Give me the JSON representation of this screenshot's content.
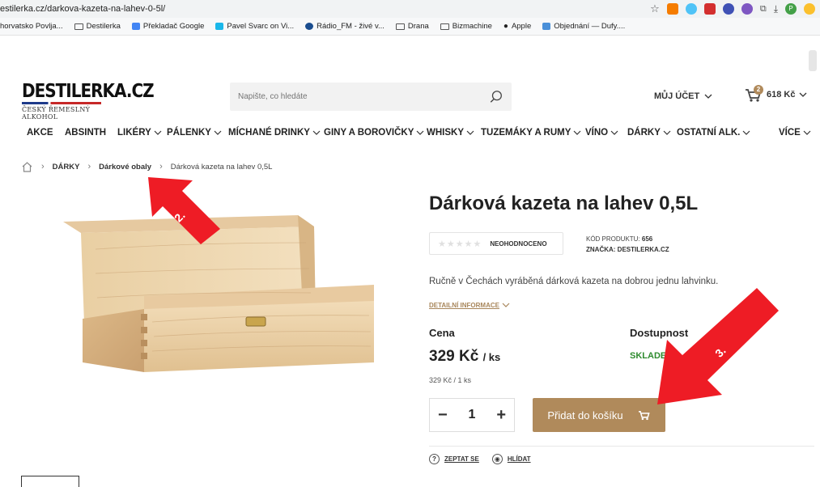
{
  "browser": {
    "url": "estilerka.cz/darkova-kazeta-na-lahev-0-5l/",
    "bookmarks": [
      "horvatsko Povlja...",
      "Destilerka",
      "Překladač Google",
      "Pavel Svarc on Vi...",
      "Rádio_FM - živé v...",
      "Drana",
      "Bizmachine",
      "Apple",
      "Objednání — Dufy...."
    ]
  },
  "header": {
    "logo_main": "DESTILERKA.CZ",
    "logo_sub": "ČESKÝ ŘEMESLNÝ ALKOHOL",
    "search_placeholder": "Napište, co hledáte",
    "account_label": "MŮJ ÚČET",
    "cart_count": "2",
    "cart_total": "618 Kč"
  },
  "nav": {
    "items": [
      "AKCE",
      "ABSINTH",
      "LIKÉRY",
      "PÁLENKY",
      "MÍCHANÉ DRINKY",
      "GINY A BOROVIČKY",
      "WHISKY",
      "TUZEMÁKY A RUMY",
      "VÍNO",
      "DÁRKY",
      "OSTATNÍ ALK.",
      "VÍCE"
    ]
  },
  "breadcrumb": {
    "level1": "DÁRKY",
    "level2": "Dárkové obaly",
    "current": "Dárková kazeta na lahev 0,5L"
  },
  "product": {
    "title": "Dárková kazeta na lahev 0,5L",
    "rating_text": "NEOHODNOCENO",
    "code_label": "KÓD PRODUKTU:",
    "code_value": "656",
    "brand_label": "ZNAČKA:",
    "brand_value": "DESTILERKA.CZ",
    "description": "Ručně v Čechách vyráběná dárková kazeta na dobrou jednu lahvinku.",
    "detail_link": "DETAILNÍ INFORMACE",
    "price_label": "Cena",
    "availability_label": "Dostupnost",
    "price": "329 Kč",
    "price_unit": "/ ks",
    "stock": "SKLADEM",
    "unit_price": "329 Kč / 1 ks",
    "quantity": "1",
    "add_to_cart": "Přidat do košíku",
    "ask_link": "ZEPTAT SE",
    "watch_link": "HLÍDAT"
  },
  "annotations": {
    "arrow2_label": "2.",
    "arrow3_label": "3."
  },
  "colors": {
    "accent": "#b08a5b",
    "stock": "#2e8b2e",
    "annotation": "#ee1c25"
  }
}
